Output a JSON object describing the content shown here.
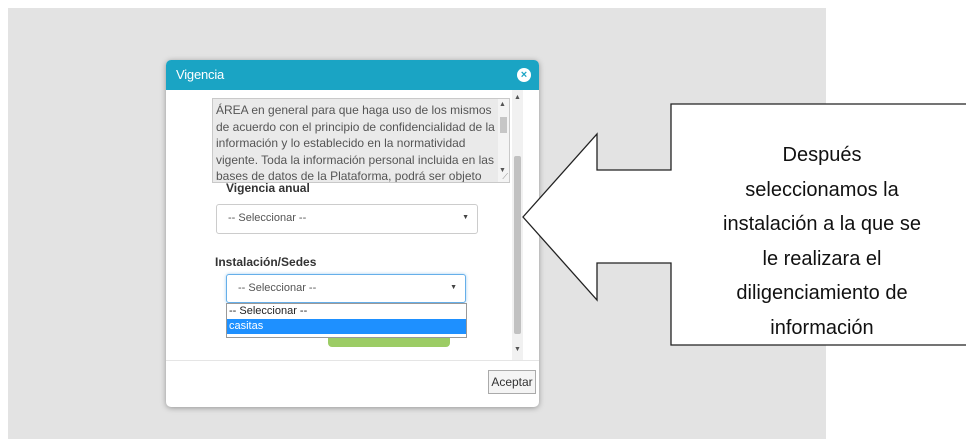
{
  "modal": {
    "title": "Vigencia",
    "close_icon": "close-icon",
    "terms_text": "ÁREA en general para que haga uso de los mismos de acuerdo con el principio de confidencialidad de la información y lo establecido en la normatividad vigente. Toda la información personal incluida en las bases de datos de la Plataforma, podrá ser objeto de",
    "vigencia_label": "Vigencia anual",
    "vigencia_value": "-- Seleccionar --",
    "instalacion_label": "Instalación/Sedes",
    "instalacion_value": "-- Seleccionar --",
    "instalacion_options": [
      "-- Seleccionar --",
      "casitas"
    ],
    "selected_option": "casitas",
    "accept_label": "Aceptar",
    "accent_color": "#1aa4c4"
  },
  "callout": {
    "lines": [
      "Después",
      "seleccionamos la",
      "instalación a la que se",
      "le realizara el",
      "diligenciamiento de",
      "información"
    ]
  }
}
